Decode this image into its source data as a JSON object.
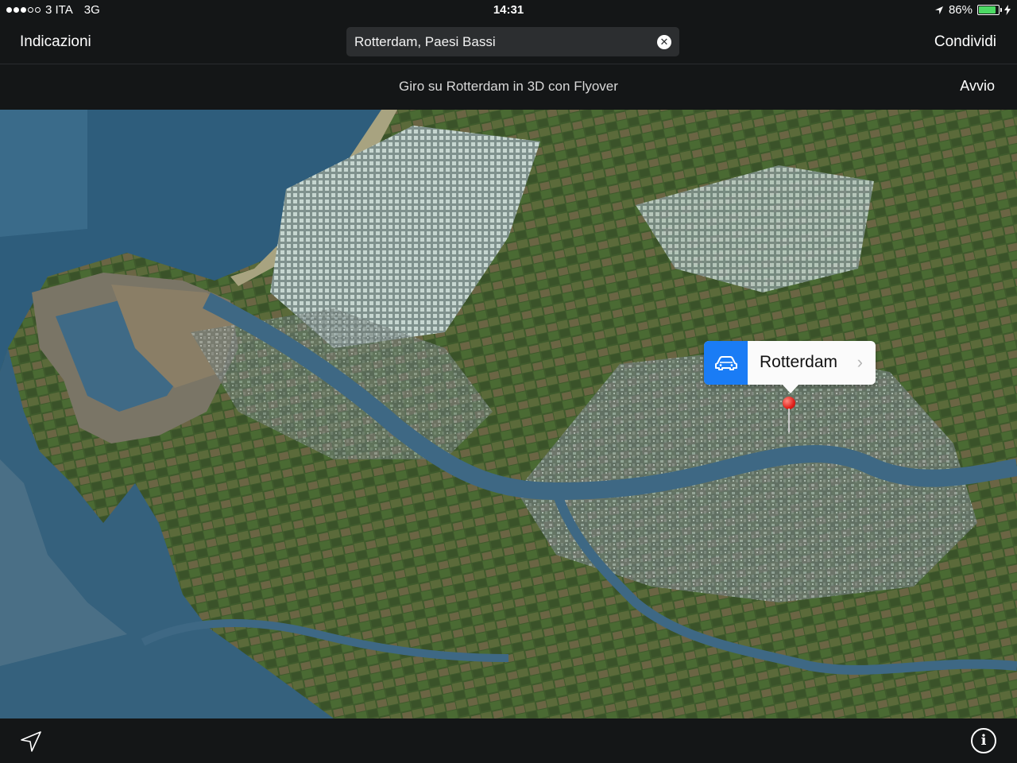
{
  "status_bar": {
    "carrier": "3 ITA",
    "network": "3G",
    "time": "14:31",
    "battery_percent": "86%",
    "battery_level": 0.86,
    "signal_bars_filled": 3,
    "signal_bars_total": 5,
    "location_icon": "location-arrow-icon",
    "charging_icon": "bolt-icon"
  },
  "nav_bar": {
    "directions_label": "Indicazioni",
    "search_value": "Rotterdam, Paesi Bassi",
    "share_label": "Condividi"
  },
  "flyover": {
    "text": "Giro su Rotterdam in 3D con Flyover",
    "start_label": "Avvio"
  },
  "callout": {
    "title": "Rotterdam",
    "car_icon": "car-icon",
    "chevron_icon": "chevron-right-icon",
    "accent_color": "#1a7cf5"
  },
  "pin": {
    "color": "#e0201a"
  },
  "toolbar": {
    "locate_icon": "location-arrow-icon",
    "info_icon": "info-icon",
    "info_symbol": "i"
  }
}
